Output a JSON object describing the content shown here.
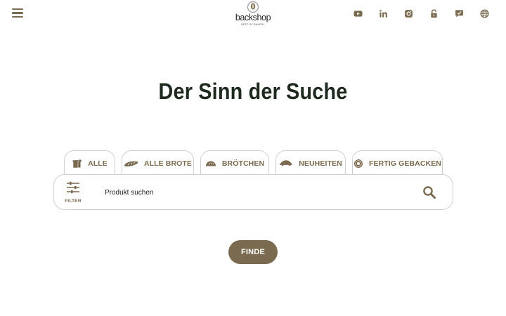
{
  "header": {
    "menu_icon": "hamburger-icon",
    "logo": {
      "word": "backshop",
      "sub": "BEST OF BAKERY"
    },
    "social": [
      {
        "name": "youtube-icon"
      },
      {
        "name": "linkedin-icon"
      },
      {
        "name": "instagram-icon"
      },
      {
        "name": "lock-icon"
      },
      {
        "name": "chat-icon"
      },
      {
        "name": "globe-icon"
      }
    ]
  },
  "main": {
    "title": "Der Sinn der Suche",
    "tabs": [
      {
        "label": "ALLE",
        "icon": "bread-slice-icon"
      },
      {
        "label": "ALLE BROTE",
        "icon": "baguette-icon"
      },
      {
        "label": "BRÖTCHEN",
        "icon": "bread-roll-icon"
      },
      {
        "label": "NEUHEITEN",
        "icon": "croissant-icon"
      },
      {
        "label": "FERTIG GEBACKEN",
        "icon": "donut-icon"
      }
    ],
    "filter_label": "FILTER",
    "search_placeholder": "Produkt suchen",
    "search_value": "",
    "submit_label": "FINDE"
  },
  "colors": {
    "accent": "#7a6a4f",
    "title": "#1f2a1f",
    "border": "#cfcfcf"
  }
}
